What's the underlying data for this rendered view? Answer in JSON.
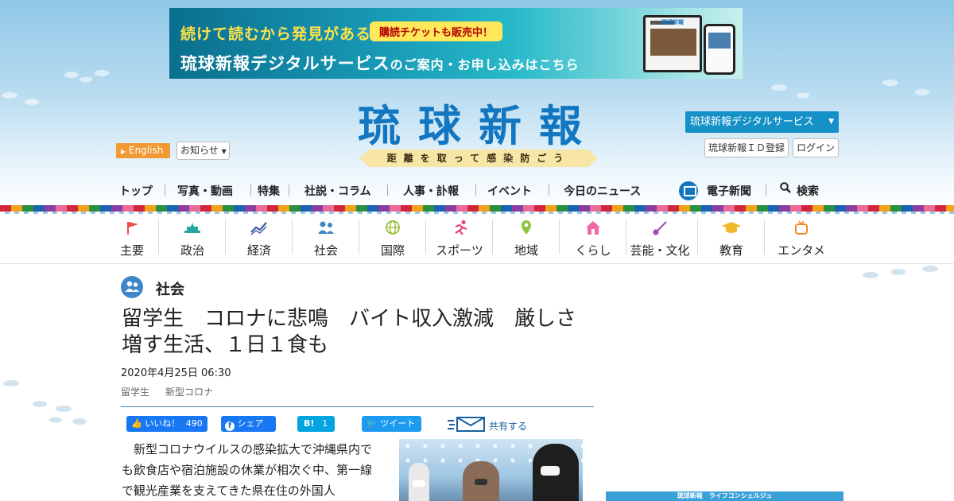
{
  "banner": {
    "line1": "続けて読むから発見がある",
    "ticket": "購読チケットも販売中！",
    "line2_a": "琉球新報デジタルサービス",
    "line2_b": "のご案内・お申し込み",
    "line2_c": "はこちら",
    "device_logo": "琉球新報"
  },
  "header": {
    "logo": "琉球新報",
    "slogan": "距離を取って感染防ごう",
    "english": "English",
    "notice": "お知らせ",
    "digital_service": "琉球新報デジタルサービス",
    "id_register": "琉球新報ＩＤ登録",
    "login": "ログイン"
  },
  "main_nav": [
    {
      "label": "トップ"
    },
    {
      "label": "写真・動画"
    },
    {
      "label": "特集"
    },
    {
      "label": "社説・コラム"
    },
    {
      "label": "人事・訃報"
    },
    {
      "label": "イベント"
    },
    {
      "label": "今日のニュース"
    },
    {
      "label": "電子新聞"
    },
    {
      "label": "検索"
    }
  ],
  "categories": [
    {
      "label": "主要",
      "icon": "flag-icon",
      "color": "#e84d4d"
    },
    {
      "label": "政治",
      "icon": "parliament-icon",
      "color": "#2aa6a0"
    },
    {
      "label": "経済",
      "icon": "chart-line-icon",
      "color": "#3c5aa6"
    },
    {
      "label": "社会",
      "icon": "people-icon",
      "color": "#3f86c8"
    },
    {
      "label": "国際",
      "icon": "globe-icon",
      "color": "#9bc23c"
    },
    {
      "label": "スポーツ",
      "icon": "runner-icon",
      "color": "#e8467c"
    },
    {
      "label": "地域",
      "icon": "map-pin-icon",
      "color": "#8cc63f"
    },
    {
      "label": "くらし",
      "icon": "house-icon",
      "color": "#ee6aa0"
    },
    {
      "label": "芸能・文化",
      "icon": "sanshin-icon",
      "color": "#9a4fb0"
    },
    {
      "label": "教育",
      "icon": "graduation-cap-icon",
      "color": "#f0b92a"
    },
    {
      "label": "エンタメ",
      "icon": "tv-icon",
      "color": "#f08a24"
    }
  ],
  "article": {
    "section": "社会",
    "headline": "留学生　コロナに悲鳴　バイト収入激減　厳しさ増す生活、１日１食も",
    "date": "2020年4月25日 06:30",
    "tags": [
      "留学生",
      "新型コロナ"
    ],
    "body": "新型コロナウイルスの感染拡大で沖縄県内でも飲食店や宿泊施設の休業が相次ぐ中、第一線で観光産業を支えてきた県在住の外国人"
  },
  "social": {
    "like_label": "いいね！",
    "like_count": "490",
    "share_label": "シェア",
    "hatena_label": "B!",
    "hatena_count": "1",
    "tweet_label": "ツイート",
    "share_all": "共有する"
  },
  "sidebar": {
    "ad_label": "琉球新報　ライフコンシェルジュ"
  }
}
